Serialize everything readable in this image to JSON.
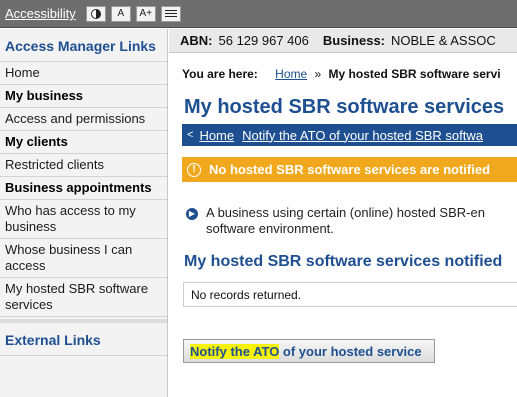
{
  "topbar": {
    "accessibility_label": "Accessibility",
    "contrast_icon": "contrast-icon",
    "font_decrease_label": "A",
    "font_increase_label": "A+",
    "menu_icon": "menu-icon"
  },
  "sidebar": {
    "heading": "Access Manager Links",
    "items": [
      {
        "label": "Home",
        "bold": false
      },
      {
        "label": "My business",
        "bold": true
      },
      {
        "label": "Access and permissions",
        "bold": false
      },
      {
        "label": "My clients",
        "bold": true
      },
      {
        "label": "Restricted clients",
        "bold": false
      },
      {
        "label": "Business appointments",
        "bold": true
      },
      {
        "label": "Who has access to my business",
        "bold": false
      },
      {
        "label": "Whose business I can access",
        "bold": false
      },
      {
        "label": "My hosted SBR software services",
        "bold": false
      }
    ],
    "external_heading": "External Links"
  },
  "abn_bar": {
    "abn_label": "ABN:",
    "abn_value": "56 129 967 406",
    "business_label": "Business:",
    "business_value": "NOBLE & ASSOC"
  },
  "breadcrumb": {
    "prefix": "You are here:",
    "home": "Home",
    "separator": "»",
    "current": "My hosted SBR software servi"
  },
  "page": {
    "title": "My hosted SBR software services",
    "nav": {
      "arrow": "<",
      "home": "Home",
      "notify": "Notify the ATO of your hosted SBR softwa"
    },
    "warning": "No hosted SBR software services are notified",
    "info_line1": "A business using certain (online) hosted SBR-en",
    "info_line2": "software environment.",
    "section_title": "My hosted SBR software services notified",
    "records_text": "No records returned.",
    "notify_button_highlight": "Notify the ATO",
    "notify_button_rest": " of your hosted service"
  },
  "colors": {
    "brand_blue": "#1d4f91",
    "warning_orange": "#f2a81d",
    "highlight_yellow": "#f6f20a",
    "topbar_gray": "#6e6e6e"
  }
}
